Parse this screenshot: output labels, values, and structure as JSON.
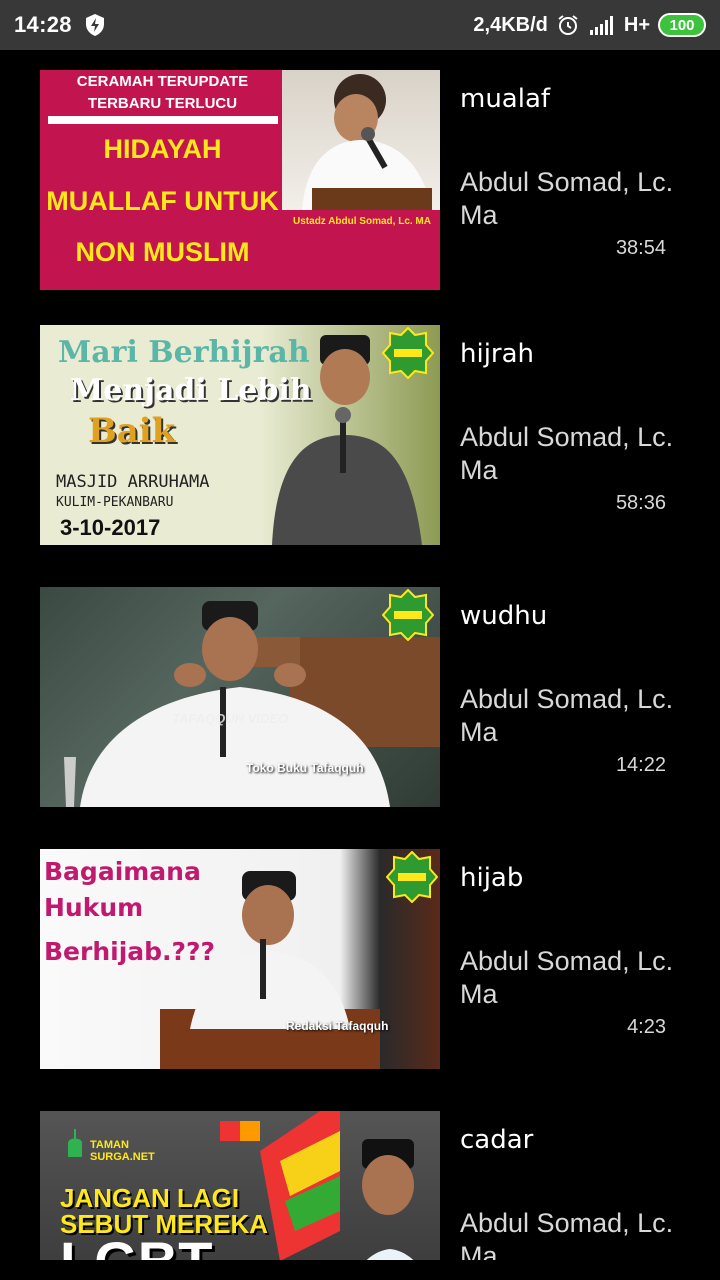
{
  "status_bar": {
    "time": "14:28",
    "speed": "2,4KB/d",
    "network": "H+",
    "battery": "100"
  },
  "videos": [
    {
      "title": "mualaf",
      "author": "Abdul Somad, Lc. Ma",
      "duration": "38:54",
      "thumb": {
        "header_lines": [
          "CERAMAH TERUPDATE",
          "TERBARU TERLUCU"
        ],
        "main_lines": [
          "HIDAYAH",
          "MUALLAF UNTUK",
          "NON MUSLIM"
        ],
        "caption": "Ustadz Abdul Somad, Lc. MA"
      }
    },
    {
      "title": "hijrah",
      "author": "Abdul Somad, Lc. Ma",
      "duration": "58:36",
      "thumb": {
        "line1": "Mari Berhijrah",
        "line2": "Menjadi Lebih",
        "line3": "Baik",
        "place": "MASJID ARRUHAMA",
        "city": "KULIM-PEKANBARU",
        "date": "3-10-2017",
        "badge": "TAFAQQUH"
      }
    },
    {
      "title": "wudhu",
      "author": "Abdul Somad, Lc. Ma",
      "duration": "14:22",
      "thumb": {
        "watermark": "TAFAQQUH VIDEO",
        "caption": "Toko Buku Tafaqquh",
        "badge": "TAFAQQUH"
      }
    },
    {
      "title": "hijab",
      "author": "Abdul Somad, Lc. Ma",
      "duration": "4:23",
      "thumb": {
        "lines": [
          "Bagaimana",
          "Hukum",
          "Berhijab.???"
        ],
        "caption": "Redaksi Tafaqquh",
        "badge": "TAFAQQUH"
      }
    },
    {
      "title": "cadar",
      "author": "Abdul Somad, Lc. Ma",
      "duration": "",
      "thumb": {
        "brand": [
          "TAMAN",
          "SURGA.NET"
        ],
        "lines": [
          "JANGAN LAGI",
          "SEBUT MEREKA"
        ],
        "big": "LGBT"
      }
    }
  ],
  "colors": {
    "status_bg": "#383838",
    "battery": "#3cc23c",
    "thumb1_bg": "#c2154f",
    "accent_yellow": "#ffe81a",
    "magenta": "#c0196f"
  }
}
